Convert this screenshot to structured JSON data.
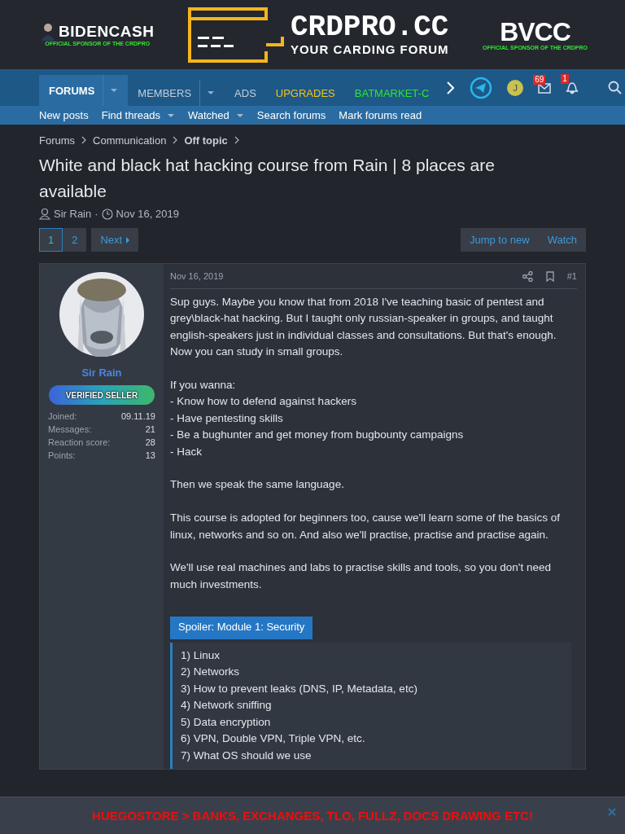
{
  "header": {
    "left_logo": {
      "text": "BIDENCASH",
      "tagline": "OFFICIAL SPONSOR OF THE CRDPRO"
    },
    "center_logo": {
      "title": "CRDPRO.CC",
      "subtitle": "YOUR CARDING FORUM"
    },
    "right_logo": {
      "text": "BVCC",
      "tagline": "OFFICIAL SPONSOR OF THE CRDPRO"
    }
  },
  "nav": {
    "tabs": [
      {
        "label": "FORUMS",
        "selected": true,
        "dropdown": true,
        "color": "#ffffff"
      },
      {
        "label": "MEMBERS",
        "selected": false,
        "dropdown": true,
        "color": "#c5ced8"
      },
      {
        "label": "ADS",
        "selected": false,
        "dropdown": false,
        "color": "#c5ced8"
      },
      {
        "label": "UPGRADES",
        "selected": false,
        "dropdown": false,
        "color": "#f4c21b"
      },
      {
        "label": "BATMARKET-C",
        "selected": false,
        "dropdown": false,
        "color": "#2ee62e"
      }
    ],
    "avatar_letter": "J",
    "inbox_count": "69",
    "alerts_count": "1"
  },
  "subnav": [
    {
      "label": "New posts",
      "dropdown": false
    },
    {
      "label": "Find threads",
      "dropdown": true
    },
    {
      "label": "Watched",
      "dropdown": true
    },
    {
      "label": "Search forums",
      "dropdown": false
    },
    {
      "label": "Mark forums read",
      "dropdown": false
    }
  ],
  "breadcrumbs": [
    {
      "label": "Forums",
      "current": false
    },
    {
      "label": "Communication",
      "current": false
    },
    {
      "label": "Off topic",
      "current": true
    }
  ],
  "thread": {
    "title": "White and black hat hacking course from Rain | 8 places are available",
    "author": "Sir Rain",
    "separator": "·",
    "date": "Nov 16, 2019"
  },
  "pagination": {
    "pages": [
      {
        "label": "1",
        "selected": true
      },
      {
        "label": "2",
        "selected": false
      }
    ],
    "next": "Next",
    "actions": [
      "Jump to new",
      "Watch"
    ]
  },
  "post": {
    "user": {
      "name": "Sir Rain",
      "banner": "VERIFIED SELLER",
      "stats": [
        {
          "label": "Joined:",
          "value": "09.11.19"
        },
        {
          "label": "Messages:",
          "value": "21"
        },
        {
          "label": "Reaction score:",
          "value": "28"
        },
        {
          "label": "Points:",
          "value": "13"
        }
      ]
    },
    "date": "Nov 16, 2019",
    "number": "#1",
    "paragraphs": [
      "Sup guys. Maybe you know that from 2018 I've teaching basic of pentest and grey\\black-hat hacking. But I taught only russian-speaker in groups, and taught english-speakers just in individual classes and consultations. But that's enough. Now you can study in small groups.",
      "If you wanna:\n- Know how to defend against hackers\n- Have pentesting skills\n- Be a bughunter and get money from bugbounty campaigns\n- Hack",
      "Then we speak the same language.",
      "This course is adopted for beginners too, cause we'll learn some of the basics of linux, networks and so on. And also we'll practise, practise and practise again.",
      "We'll use real machines and labs to practise skills and tools, so you don't need much investments."
    ],
    "spoiler": {
      "label": "Spoiler: Module 1: Security",
      "items": [
        "1) Linux",
        "2) Networks",
        "3) How to prevent leaks (DNS, IP, Metadata, etc)",
        "4) Network sniffing",
        "5) Data encryption",
        "6) VPN, Double VPN, Triple VPN, etc.",
        "7) What OS should we use"
      ]
    }
  },
  "bottom_banner": {
    "text": "HUEGOSTORE > BANKS, EXCHANGES, TLO, FULLZ, DOCS DRAWING ETC!"
  }
}
